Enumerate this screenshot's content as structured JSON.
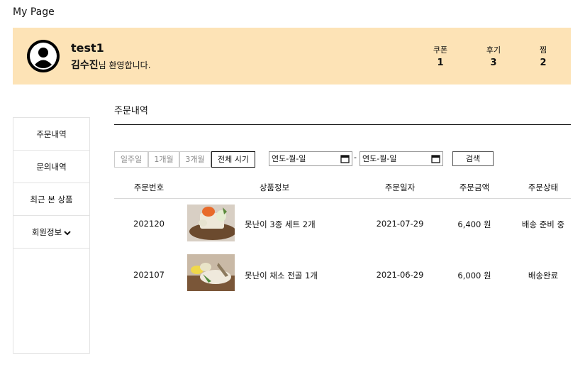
{
  "page": {
    "title": "My Page"
  },
  "user": {
    "id": "test1",
    "name": "김수진",
    "welcome_suffix": "님 환영합니다."
  },
  "stats": [
    {
      "label": "쿠폰",
      "value": "1"
    },
    {
      "label": "후기",
      "value": "3"
    },
    {
      "label": "찜",
      "value": "2"
    }
  ],
  "sidebar": {
    "items": [
      {
        "label": "주문내역"
      },
      {
        "label": "문의내역"
      },
      {
        "label": "최근 본 상품"
      },
      {
        "label": "회원정보"
      }
    ]
  },
  "section": {
    "title": "주문내역"
  },
  "filters": {
    "periods": [
      "일주일",
      "1개월",
      "3개월",
      "전체 시기"
    ],
    "active_period": "전체 시기",
    "date_start_placeholder": "연도-월-일",
    "date_end_placeholder": "연도-월-일",
    "date_separator": "-",
    "search_label": "검색"
  },
  "table": {
    "columns": [
      "주문번호",
      "상품정보",
      "주문일자",
      "주문금액",
      "주문상태"
    ],
    "rows": [
      {
        "order_no": "202120",
        "product": "못난이 3종 세트 2개",
        "date": "2021-07-29",
        "amount": "6,400 원",
        "status": "배송 준비 중"
      },
      {
        "order_no": "202107",
        "product": "못난이 채소 전골 1개",
        "date": "2021-06-29",
        "amount": "6,000 원",
        "status": "배송완료"
      }
    ]
  },
  "icons": {
    "avatar": "user-avatar-icon",
    "calendar": "calendar-icon",
    "chevron": "chevron-down-icon"
  },
  "colors": {
    "banner": "#fde3b6",
    "text": "#111111",
    "border": "#e3e3e3"
  }
}
